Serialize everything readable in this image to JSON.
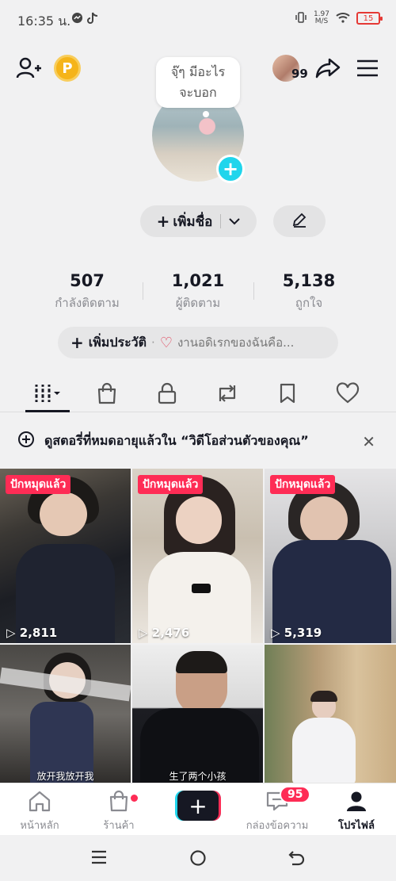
{
  "status_bar": {
    "time": "16:35 น.",
    "network_speed": "1.97",
    "network_unit": "M/S",
    "battery": "15",
    "colors": {
      "battery_low": "#e53935"
    }
  },
  "header": {
    "note_bubble_text_line1": "จฺ๊ๆ มีอะไร",
    "note_bubble_text_line2": "จะบอก",
    "friends_count": "99",
    "coin_letter": "P",
    "icons": [
      "add-friend-icon",
      "coin-icon",
      "share-icon",
      "menu-icon"
    ]
  },
  "profile": {
    "add_name_label": "เพิ่มชื่อ",
    "add_bio_label": "เพิ่มประวัติ",
    "bio_preview": "งานอดิเรกของฉันคือ..."
  },
  "stats": [
    {
      "value": "507",
      "label": "กำลังติดตาม"
    },
    {
      "value": "1,021",
      "label": "ผู้ติดตาม"
    },
    {
      "value": "5,138",
      "label": "ถูกใจ"
    }
  ],
  "tabs": [
    "videos-tab",
    "shop-tab",
    "private-tab",
    "reposts-tab",
    "favorites-tab",
    "liked-tab"
  ],
  "banner": {
    "text": "ดูสตอรี่ที่หมดอายุแล้วใน “วิดีโอส่วนตัวของคุณ”"
  },
  "videos": [
    {
      "pinned_label": "ปักหมุดแล้ว",
      "views": "2,811"
    },
    {
      "pinned_label": "ปักหมุดแล้ว",
      "views": "2,476"
    },
    {
      "pinned_label": "ปักหมุดแล้ว",
      "views": "5,319"
    },
    {
      "caption": "放开我放开我"
    },
    {
      "caption": "生了两个小孩"
    },
    {
      "caption": ""
    }
  ],
  "bottom_nav": {
    "home": "หน้าหลัก",
    "shop": "ร้านค้า",
    "inbox": "กล่องข้อความ",
    "inbox_badge": "95",
    "profile": "โปรไฟล์"
  },
  "colors": {
    "accent_red": "#fe2c55",
    "accent_cyan": "#20d5ec",
    "text_primary": "#161823"
  }
}
